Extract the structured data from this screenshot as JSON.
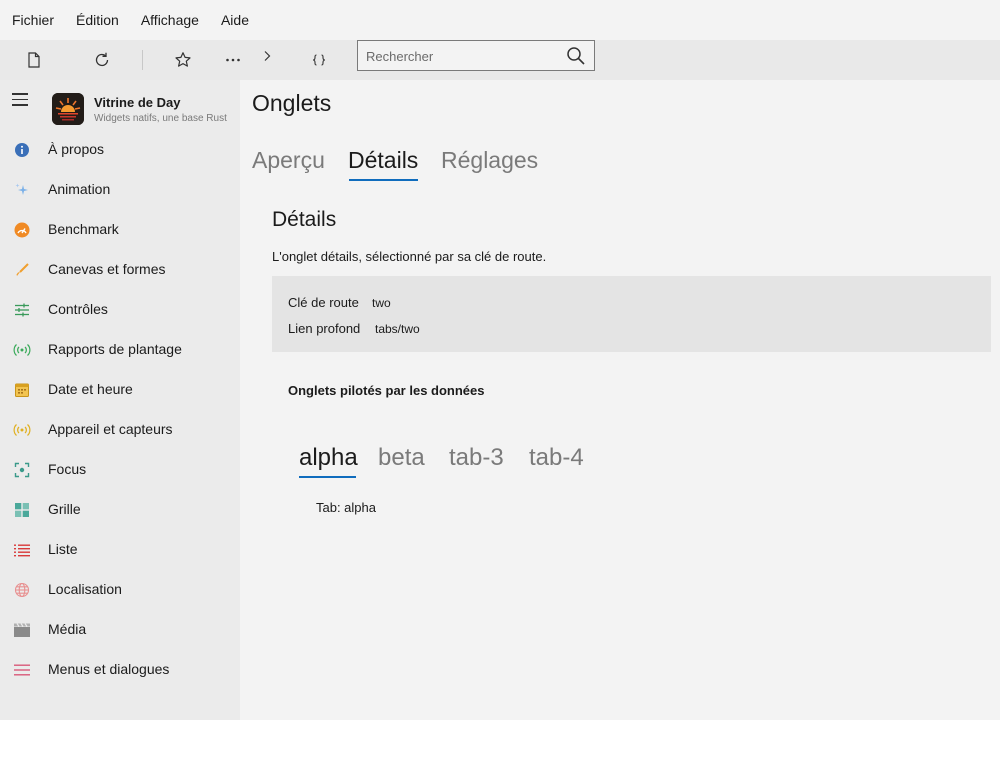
{
  "menubar": {
    "items": [
      "Fichier",
      "Édition",
      "Affichage",
      "Aide"
    ]
  },
  "toolbar": {
    "buttons": [
      "new-document-icon",
      "refresh-icon",
      "star-icon",
      "more-icon",
      "chevron-right-icon",
      "braces-icon"
    ],
    "search": {
      "placeholder": "Rechercher",
      "value": ""
    }
  },
  "sidebar": {
    "app_name": "Vitrine de Day",
    "app_subtitle": "Widgets natifs, une base Rust",
    "items": [
      {
        "label": "À propos",
        "icon": "info-icon",
        "color": "#2f6fbf"
      },
      {
        "label": "Animation",
        "icon": "sparkle-icon",
        "color": "#7ab0e8"
      },
      {
        "label": "Benchmark",
        "icon": "gauge-icon",
        "color": "#f08a24"
      },
      {
        "label": "Canevas et formes",
        "icon": "brush-icon",
        "color": "#f0a030"
      },
      {
        "label": "Contrôles",
        "icon": "sliders-icon",
        "color": "#3a9a5a"
      },
      {
        "label": "Rapports de plantage",
        "icon": "broadcast-icon",
        "color": "#3aaa5a"
      },
      {
        "label": "Date et heure",
        "icon": "calendar-icon",
        "color": "#d8a020"
      },
      {
        "label": "Appareil et capteurs",
        "icon": "sensor-icon",
        "color": "#e0b020"
      },
      {
        "label": "Focus",
        "icon": "focus-icon",
        "color": "#3a9a8a"
      },
      {
        "label": "Grille",
        "icon": "grid-icon",
        "color": "#3a9a8a"
      },
      {
        "label": "Liste",
        "icon": "list-icon",
        "color": "#d83a3a"
      },
      {
        "label": "Localisation",
        "icon": "globe-icon",
        "color": "#e89090"
      },
      {
        "label": "Média",
        "icon": "clapperboard-icon",
        "color": "#8a8a8a"
      },
      {
        "label": "Menus et dialogues",
        "icon": "menu-lines-icon",
        "color": "#d85a7a"
      }
    ]
  },
  "main": {
    "title": "Onglets",
    "tabs": [
      {
        "label": "Aperçu",
        "active": false
      },
      {
        "label": "Détails",
        "active": true
      },
      {
        "label": "Réglages",
        "active": false
      }
    ],
    "section_title": "Détails",
    "section_desc": "L'onglet détails, sélectionné par sa clé de route.",
    "info": [
      {
        "key": "Clé de route",
        "value": "two"
      },
      {
        "key": "Lien profond",
        "value": "tabs/two"
      }
    ],
    "data_tabs_title": "Onglets pilotés par les données",
    "data_tabs": [
      {
        "label": "alpha",
        "active": true
      },
      {
        "label": "beta",
        "active": false
      },
      {
        "label": "tab-3",
        "active": false
      },
      {
        "label": "tab-4",
        "active": false
      }
    ],
    "tab_content": "Tab: alpha"
  },
  "colors": {
    "accent": "#0f6cbd"
  }
}
